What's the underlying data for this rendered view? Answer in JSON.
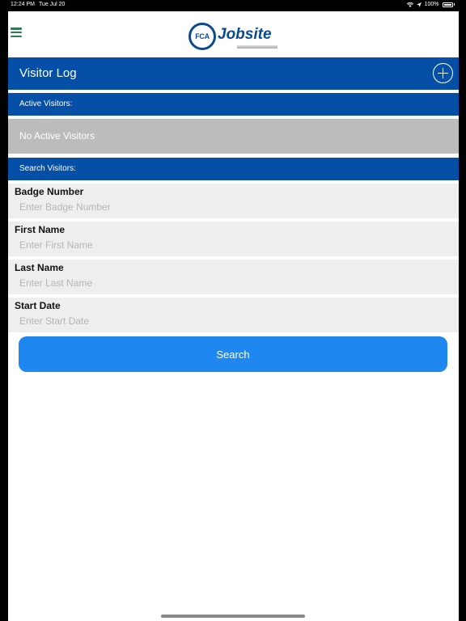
{
  "status_bar": {
    "time": "12:24 PM",
    "date": "Tue Jul 20",
    "battery": "100%"
  },
  "header": {
    "logo_badge": "FCA",
    "logo_text": "Jobsite"
  },
  "title_bar": {
    "title": "Visitor Log"
  },
  "active_visitors": {
    "header": "Active Visitors:",
    "empty_message": "No Active Visitors"
  },
  "search": {
    "header": "Search Visitors:",
    "fields": [
      {
        "label": "Badge Number",
        "placeholder": "Enter Badge Number",
        "value": ""
      },
      {
        "label": "First Name",
        "placeholder": "Enter First Name",
        "value": ""
      },
      {
        "label": "Last Name",
        "placeholder": "Enter Last Name",
        "value": ""
      },
      {
        "label": "Start Date",
        "placeholder": "Enter Start Date",
        "value": ""
      }
    ],
    "button_label": "Search"
  },
  "colors": {
    "primary_blue": "#0550a6",
    "button_blue": "#1e88f0",
    "menu_green": "#2e7d4f",
    "empty_gray": "#bcbcbc"
  }
}
